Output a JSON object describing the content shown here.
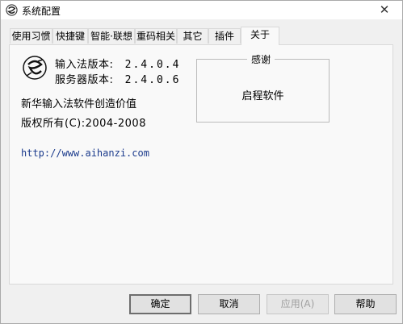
{
  "window": {
    "title": "系统配置",
    "close_symbol": "✕"
  },
  "tabs": [
    {
      "label": "使用习惯"
    },
    {
      "label": "快捷键"
    },
    {
      "label": "智能·联想"
    },
    {
      "label": "重码相关"
    },
    {
      "label": "其它"
    },
    {
      "label": "插件"
    },
    {
      "label": "关于",
      "active": true
    }
  ],
  "about": {
    "ime_version_label": "输入法版本:",
    "ime_version": "2.4.0.4",
    "server_version_label": "服务器版本:",
    "server_version": "2.4.0.6",
    "slogan": "新华输入法软件创造价值",
    "copyright": "版权所有(C):2004-2008",
    "url": "http://www.aihanzi.com",
    "thanks_title": "感谢",
    "thanks_text": "启程软件"
  },
  "buttons": {
    "ok": "确定",
    "cancel": "取消",
    "apply": "应用(A)",
    "help": "帮助"
  },
  "icons": {
    "app": "app-logo-icon",
    "close": "close-icon"
  }
}
